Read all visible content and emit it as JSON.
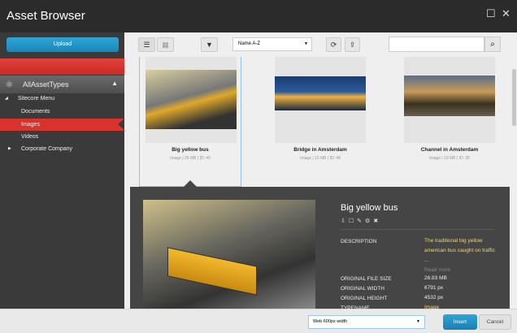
{
  "title": "Asset Browser",
  "sidebar": {
    "upload": "Upload",
    "root": "AllAssetTypes",
    "items": [
      {
        "label": "Sitecore Menu"
      },
      {
        "label": "Documents"
      },
      {
        "label": "Images"
      },
      {
        "label": "Videos"
      },
      {
        "label": "Corporate Company"
      }
    ]
  },
  "toolbar": {
    "sort": "Name A-Z",
    "search_placeholder": ""
  },
  "cards": [
    {
      "name": "Big yellow bus",
      "meta": "Image | 26 MB | ID: 49"
    },
    {
      "name": "Bridge in Amsterdam",
      "meta": "Image | 15 MB | ID: 48"
    },
    {
      "name": "Channel in Amsterdam",
      "meta": "Image | 10 MB | ID: 35"
    }
  ],
  "detail": {
    "title": "Big yellow bus",
    "rows": [
      {
        "k": "DESCRIPTION",
        "v": "The traditional big yellow american bus caught on traffic ..."
      },
      {
        "k": "ORIGINAL FILE SIZE",
        "v": "26.83 MB"
      },
      {
        "k": "ORIGINAL WIDTH",
        "v": "6791 px"
      },
      {
        "k": "ORIGINAL HEIGHT",
        "v": "4532 px"
      },
      {
        "k": "TYPENAME",
        "v": "Image"
      }
    ],
    "read_more": "Read more"
  },
  "footer": {
    "size": "Web 600px width",
    "insert": "Insert",
    "cancel": "Cancel"
  }
}
